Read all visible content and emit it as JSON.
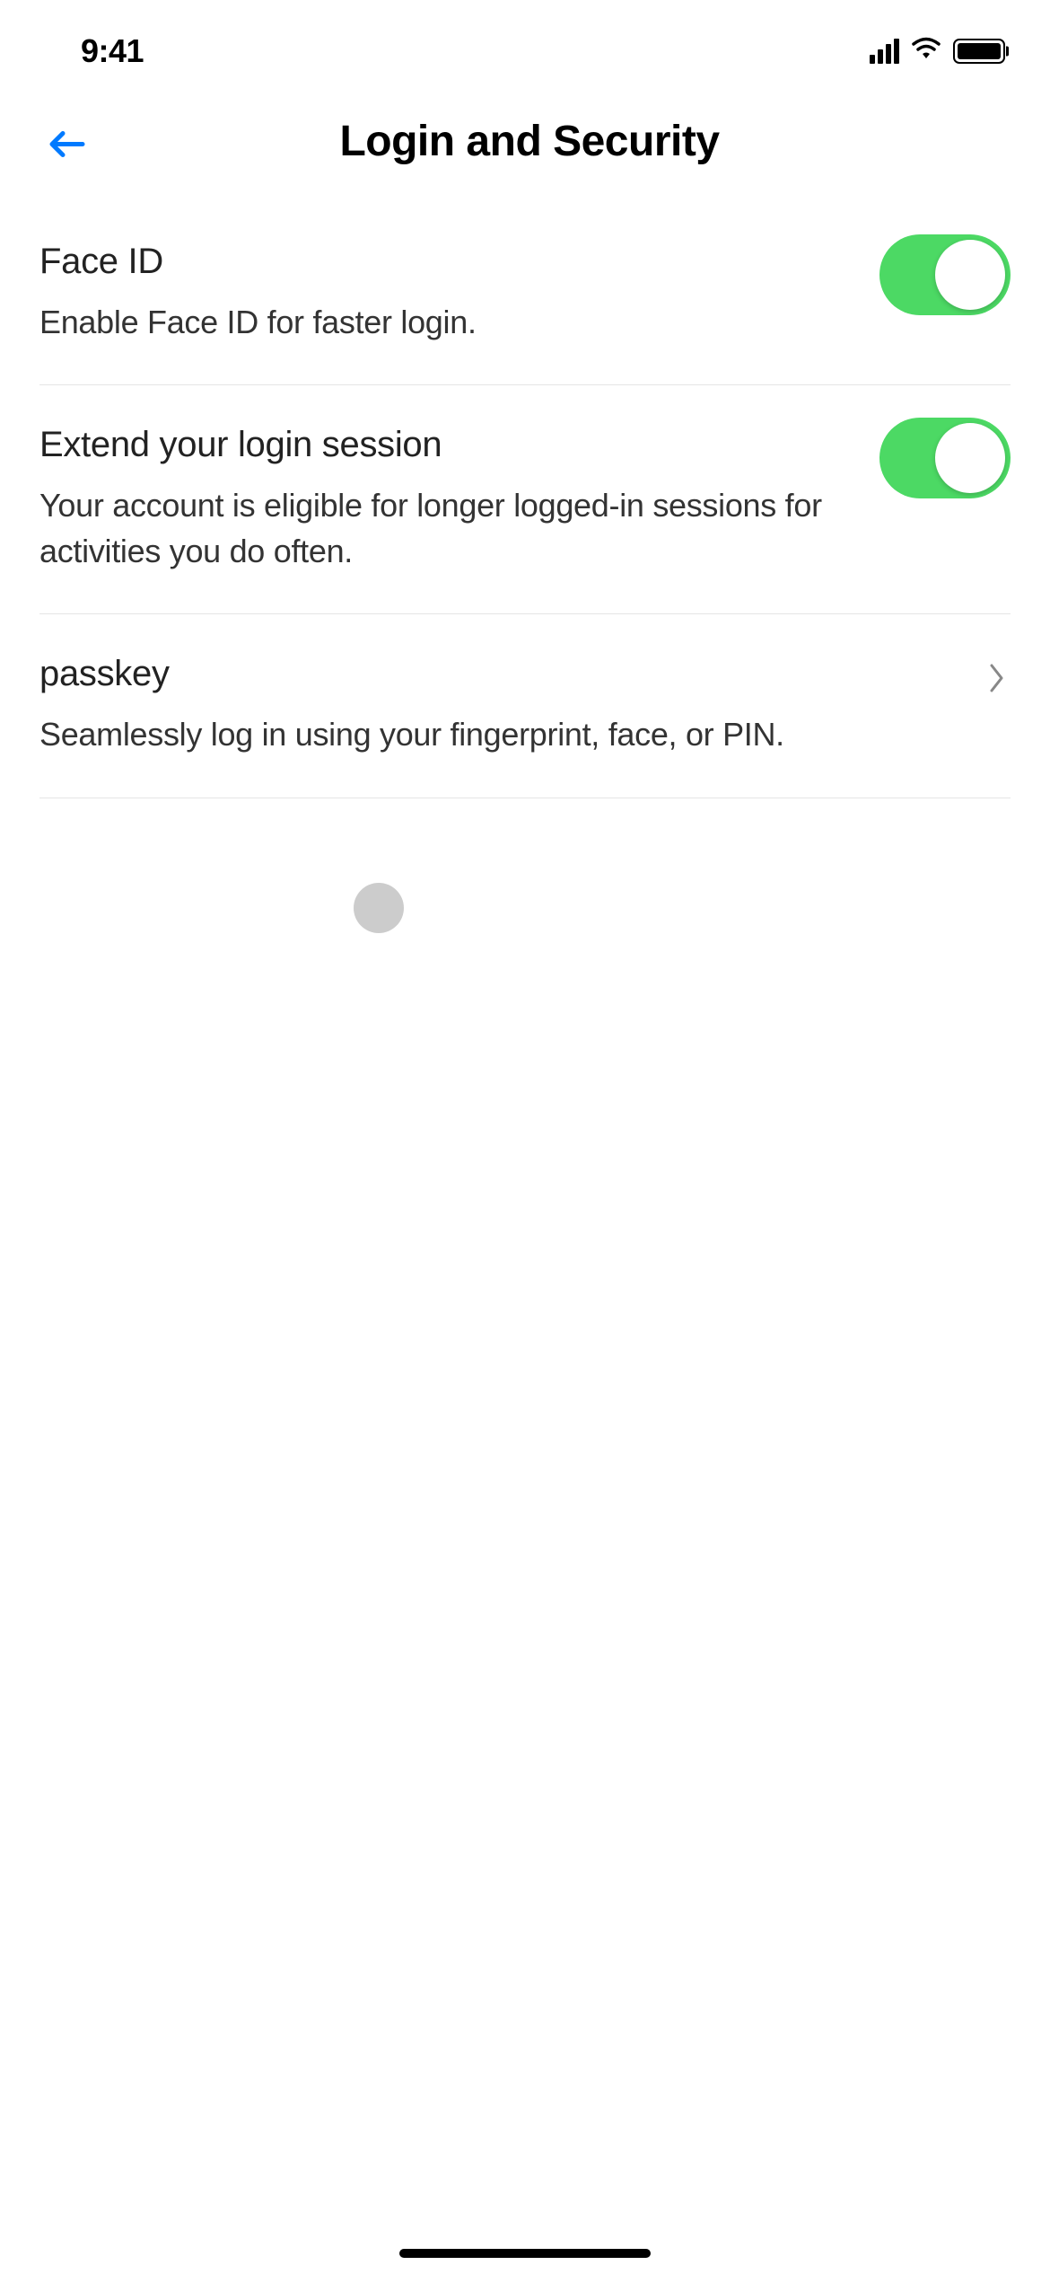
{
  "status_bar": {
    "time": "9:41"
  },
  "header": {
    "title": "Login and Security"
  },
  "settings": {
    "face_id": {
      "title": "Face ID",
      "description": "Enable Face ID for faster login.",
      "enabled": true
    },
    "extend_session": {
      "title": "Extend your login session",
      "description": "Your account is eligible for longer logged-in sessions for activities you do often.",
      "enabled": true
    },
    "passkey": {
      "title": "passkey",
      "description": "Seamlessly log in using your fingerprint, face, or PIN."
    }
  },
  "colors": {
    "toggle_on": "#4cd964",
    "back_arrow": "#007aff"
  }
}
